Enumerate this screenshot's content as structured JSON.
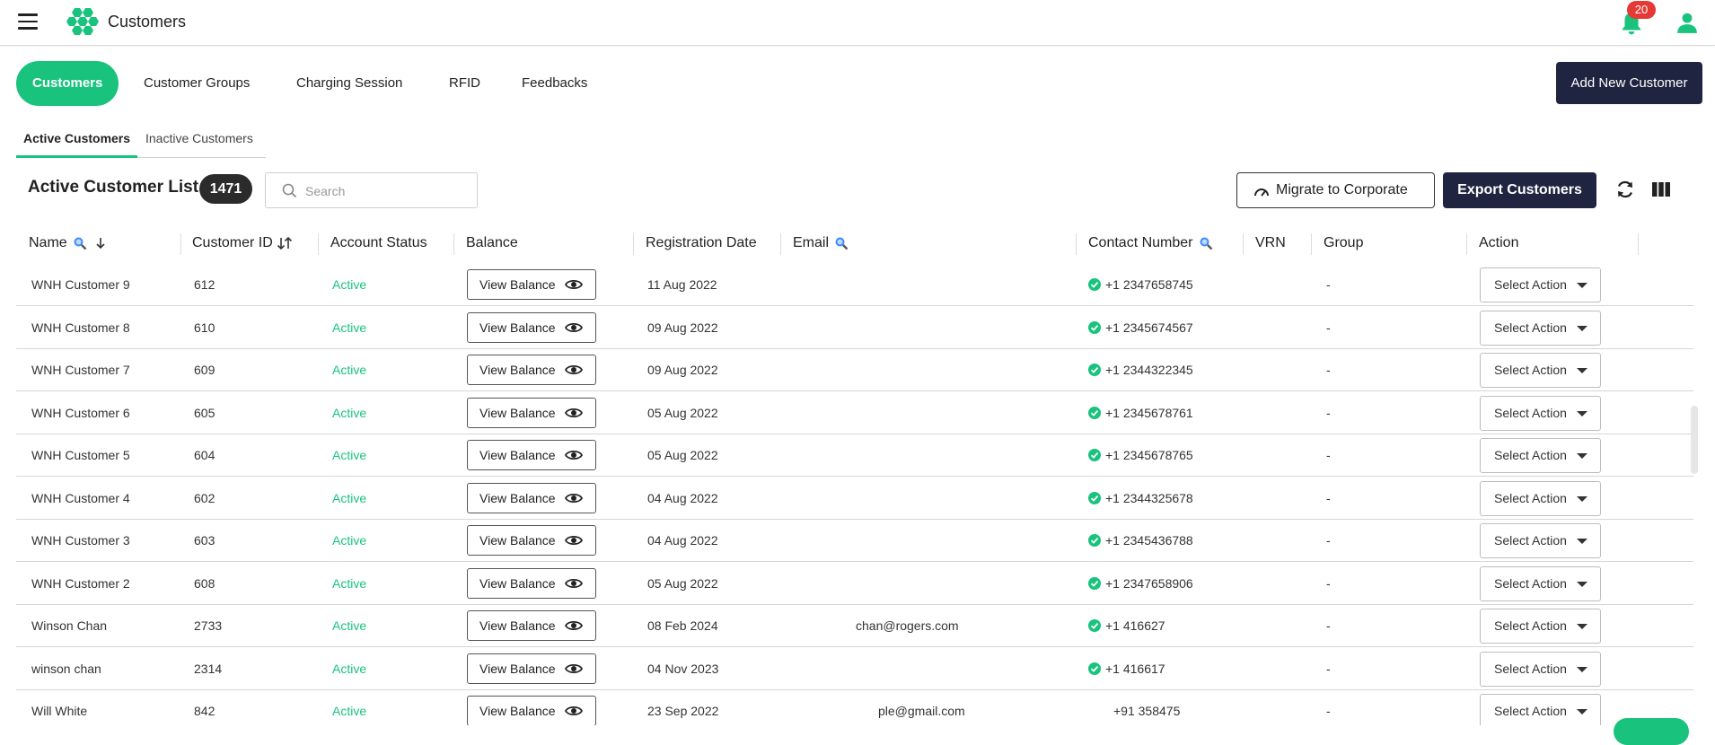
{
  "header": {
    "title": "Customers",
    "notification_count": "20",
    "brand_color": "#19c37d"
  },
  "main_tabs": [
    {
      "label": "Customers",
      "active": true
    },
    {
      "label": "Customer Groups",
      "active": false
    },
    {
      "label": "Charging Session",
      "active": false
    },
    {
      "label": "RFID",
      "active": false
    },
    {
      "label": "Feedbacks",
      "active": false
    }
  ],
  "add_button_label": "Add New Customer",
  "sub_tabs": [
    {
      "label": "Active Customers",
      "active": true
    },
    {
      "label": "Inactive Customers",
      "active": false
    }
  ],
  "list": {
    "title": "Active Customer List",
    "count": "1471",
    "search_placeholder": "Search",
    "migrate_label": "Migrate to Corporate",
    "export_label": "Export Customers"
  },
  "columns": {
    "name": "Name",
    "customer_id": "Customer ID",
    "account_status": "Account Status",
    "balance": "Balance",
    "registration_date": "Registration Date",
    "email": "Email",
    "contact_number": "Contact Number",
    "vrn": "VRN",
    "group": "Group",
    "action": "Action"
  },
  "row_labels": {
    "view_balance": "View Balance",
    "select_action": "Select Action"
  },
  "rows": [
    {
      "name": "WNH Customer 9",
      "id": "612",
      "status": "Active",
      "date": "11 Aug 2022",
      "email": "",
      "contact": "+1 2347658745",
      "verified": true,
      "group": "-"
    },
    {
      "name": "WNH Customer 8",
      "id": "610",
      "status": "Active",
      "date": "09 Aug 2022",
      "email": "",
      "contact": "+1 2345674567",
      "verified": true,
      "group": "-"
    },
    {
      "name": "WNH Customer 7",
      "id": "609",
      "status": "Active",
      "date": "09 Aug 2022",
      "email": "",
      "contact": "+1 2344322345",
      "verified": true,
      "group": "-"
    },
    {
      "name": "WNH Customer 6",
      "id": "605",
      "status": "Active",
      "date": "05 Aug 2022",
      "email": "",
      "contact": "+1 2345678761",
      "verified": true,
      "group": "-"
    },
    {
      "name": "WNH Customer 5",
      "id": "604",
      "status": "Active",
      "date": "05 Aug 2022",
      "email": "",
      "contact": "+1 2345678765",
      "verified": true,
      "group": "-"
    },
    {
      "name": "WNH Customer 4",
      "id": "602",
      "status": "Active",
      "date": "04 Aug 2022",
      "email": "",
      "contact": "+1 2344325678",
      "verified": true,
      "group": "-"
    },
    {
      "name": "WNH Customer 3",
      "id": "603",
      "status": "Active",
      "date": "04 Aug 2022",
      "email": "",
      "contact": "+1 2345436788",
      "verified": true,
      "group": "-"
    },
    {
      "name": "WNH Customer 2",
      "id": "608",
      "status": "Active",
      "date": "05 Aug 2022",
      "email": "",
      "contact": "+1 2347658906",
      "verified": true,
      "group": "-"
    },
    {
      "name": "Winson Chan",
      "id": "2733",
      "status": "Active",
      "date": "08 Feb 2024",
      "email": "chan@rogers.com",
      "contact": "+1 416627",
      "verified": true,
      "group": "-"
    },
    {
      "name": "winson chan",
      "id": "2314",
      "status": "Active",
      "date": "04 Nov 2023",
      "email": "",
      "contact": "+1 416617",
      "verified": true,
      "group": "-"
    },
    {
      "name": "Will White",
      "id": "842",
      "status": "Active",
      "date": "23 Sep 2022",
      "email": "ple@gmail.com",
      "contact": "+91 358475",
      "verified": false,
      "group": "-"
    }
  ]
}
